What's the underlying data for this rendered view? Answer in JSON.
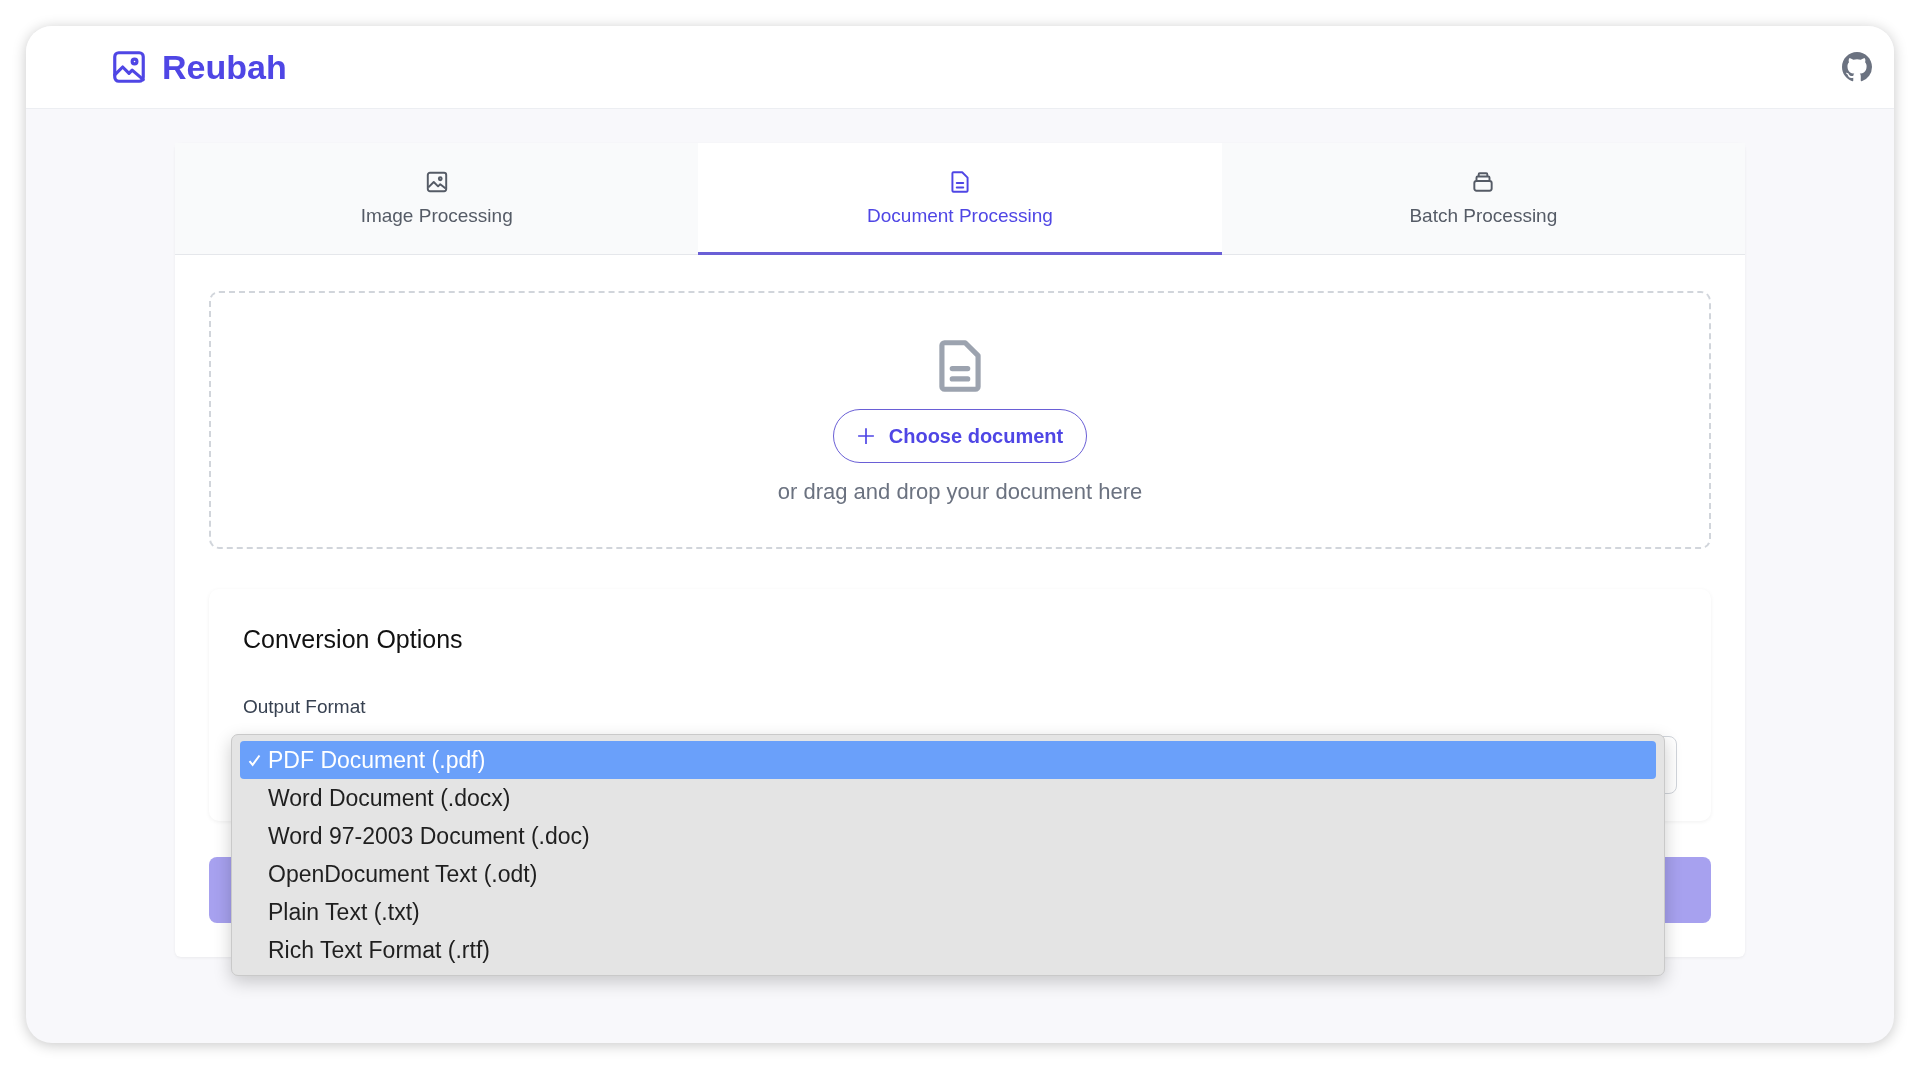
{
  "app": {
    "title": "Reubah"
  },
  "tabs": [
    {
      "label": "Image Processing",
      "selected": false
    },
    {
      "label": "Document Processing",
      "selected": true
    },
    {
      "label": "Batch Processing",
      "selected": false
    }
  ],
  "dropzone": {
    "button_label": "Choose document",
    "hint": "or drag and drop your document here"
  },
  "options": {
    "title": "Conversion Options",
    "field_label": "Output Format",
    "dropdown": {
      "expanded": true,
      "items": [
        {
          "label": "PDF Document (.pdf)",
          "selected": true
        },
        {
          "label": "Word Document (.docx)",
          "selected": false
        },
        {
          "label": "Word 97-2003 Document (.doc)",
          "selected": false
        },
        {
          "label": "OpenDocument Text (.odt)",
          "selected": false
        },
        {
          "label": "Plain Text (.txt)",
          "selected": false
        },
        {
          "label": "Rich Text Format (.rtf)",
          "selected": false
        }
      ]
    }
  }
}
